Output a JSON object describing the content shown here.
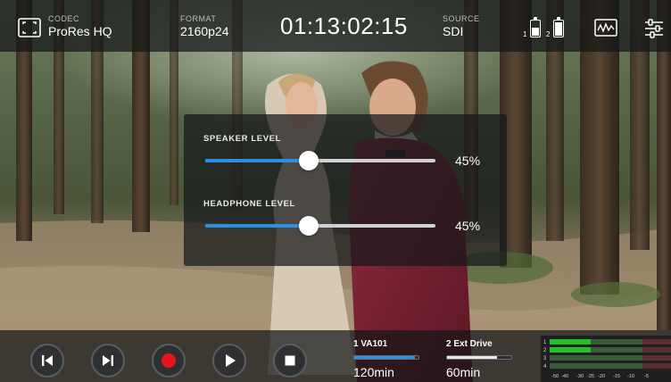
{
  "header": {
    "codec_label": "CODEC",
    "codec_value": "ProRes HQ",
    "format_label": "FORMAT",
    "format_value": "2160p24",
    "timecode": "01:13:02:15",
    "source_label": "SOURCE",
    "source_value": "SDI",
    "batteries": [
      {
        "num": "1",
        "level": 0.5
      },
      {
        "num": "2",
        "level": 0.85
      }
    ]
  },
  "levels": {
    "speaker_label": "SPEAKER LEVEL",
    "speaker_value": "45%",
    "speaker_level": 0.45,
    "headphone_label": "HEADPHONE LEVEL",
    "headphone_value": "45%",
    "headphone_level": 0.45
  },
  "transport": {
    "buttons": [
      "skip-back",
      "skip-forward",
      "record",
      "play",
      "stop"
    ]
  },
  "media": [
    {
      "name": "1  VA101",
      "time": "120min",
      "fill": 0.95,
      "color": "#2b8fe6"
    },
    {
      "name": "2  Ext Drive",
      "time": "60min",
      "fill": 0.78,
      "color": "#e6e8ea"
    }
  ],
  "meters": {
    "channels": [
      "1",
      "2",
      "3",
      "4"
    ],
    "scale": [
      "-50",
      "-40",
      "-30",
      "-25",
      "-20",
      "-15",
      "-10",
      "-5"
    ]
  },
  "colors": {
    "accent": "#2b8fe6",
    "record": "#e8141c",
    "meter_green": "#22c12a"
  }
}
